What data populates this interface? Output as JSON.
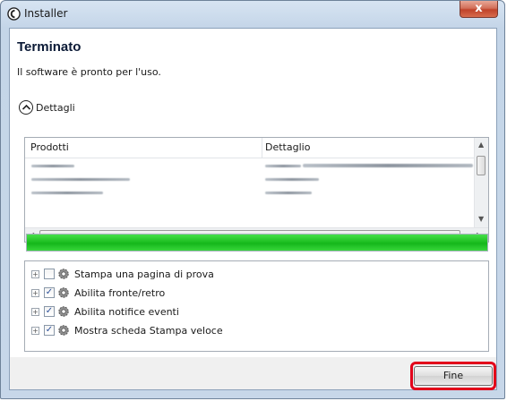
{
  "window": {
    "title": "Installer",
    "close_label": "x"
  },
  "page": {
    "heading": "Terminato",
    "subtitle": "Il software è pronto per l'uso.",
    "details_label": "Dettagli"
  },
  "products": {
    "columns": [
      "Prodotti",
      "Dettaglio"
    ],
    "rows_redacted": true
  },
  "progress": {
    "value": 1.0,
    "color": "#1fc023"
  },
  "options": [
    {
      "label": "Stampa una pagina di prova",
      "checked": false
    },
    {
      "label": "Abilita fronte/retro",
      "checked": true
    },
    {
      "label": "Abilita notifice eventi",
      "checked": true
    },
    {
      "label": "Mostra scheda Stampa veloce",
      "checked": true
    }
  ],
  "footer": {
    "finish_label": "Fine",
    "highlight_color": "#e2001a"
  }
}
